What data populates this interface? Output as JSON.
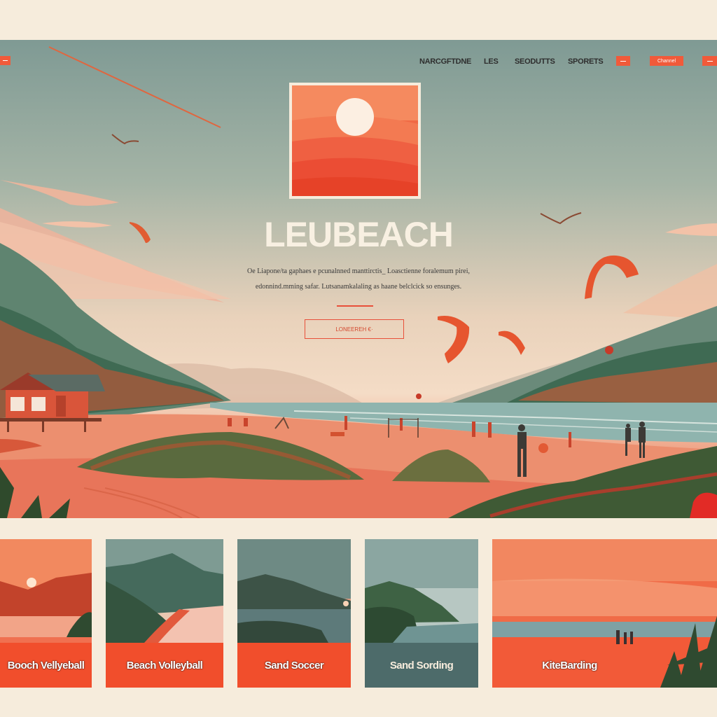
{
  "nav": {
    "links": [
      "NARCGFTDNE",
      "LES",
      "SEODUTTS",
      "SPORETS"
    ],
    "button_label": "Channel"
  },
  "hero": {
    "brand": "LEUBEACH",
    "tagline_line1": "Oe Liapone/ta gaphaes e pcunalnned manttirctis_ Loasctienne foralemum pirei,",
    "tagline_line2": "edonnind.mming safar. Lutsanamkalaling as haane belclcick so ensunges.",
    "cta_label": "LONEEREH €·"
  },
  "cards": [
    {
      "label": "Booch Vellyeball"
    },
    {
      "label": "Beach Volleyball"
    },
    {
      "label": "Sand Soccer"
    },
    {
      "label": "Sand Sording"
    },
    {
      "label": "KiteBarding"
    }
  ],
  "colors": {
    "accent": "#f15a3a",
    "background": "#f6ecdc",
    "sky": "#7f9a94",
    "teal_card": "#4d6b6a"
  }
}
